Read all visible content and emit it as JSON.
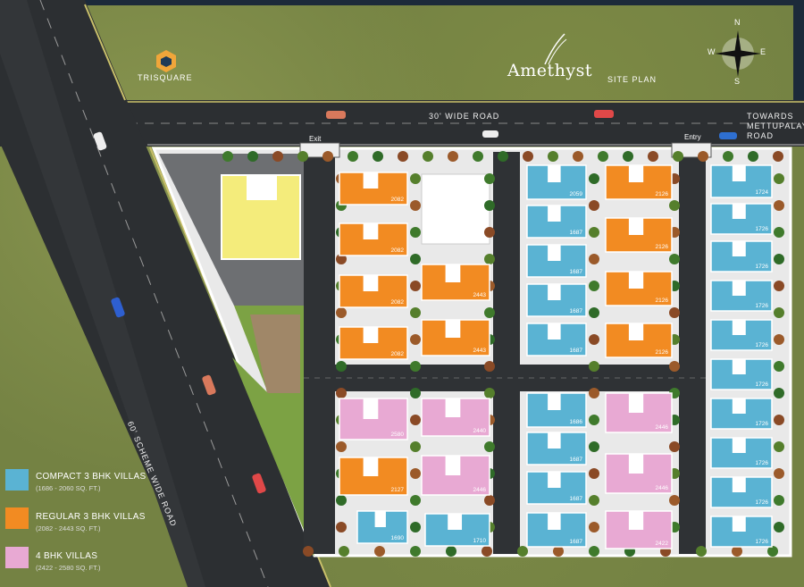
{
  "header": {
    "developer": "TRISQUARE",
    "project": "Amethyst",
    "plan_title": "SITE PLAN"
  },
  "compass": {
    "n": "N",
    "s": "S",
    "e": "E",
    "w": "W"
  },
  "roads": {
    "top_road": "30' WIDE ROAD",
    "towards": "TOWARDS METTUPALAYAM ROAD",
    "scheme_road": "60' SCHEME WIDE ROAD"
  },
  "gates": {
    "exit": "Exit",
    "entry": "Entry"
  },
  "legend": [
    {
      "title": "COMPACT 3 BHK VILLAS",
      "sub": "(1686 - 2060 SQ. FT.)",
      "color": "#5ab3d3"
    },
    {
      "title": "REGULAR 3 BHK VILLAS",
      "sub": "(2082 - 2443 SQ. FT.)",
      "color": "#f28b22"
    },
    {
      "title": "4 BHK VILLAS",
      "sub": "(2422 - 2580 SQ. FT.)",
      "color": "#e8a9d3"
    }
  ],
  "plots": [
    {
      "t": "o",
      "v": "2082"
    },
    {
      "t": "o",
      "v": "2082"
    },
    {
      "t": "o",
      "v": "2082"
    },
    {
      "t": "o",
      "v": "2082"
    },
    {
      "t": "o",
      "v": "2443"
    },
    {
      "t": "o",
      "v": "2443"
    },
    {
      "t": "b",
      "v": "2059"
    },
    {
      "t": "b",
      "v": "1687"
    },
    {
      "t": "b",
      "v": "1687"
    },
    {
      "t": "b",
      "v": "1687"
    },
    {
      "t": "b",
      "v": "1687"
    },
    {
      "t": "o",
      "v": "2126"
    },
    {
      "t": "o",
      "v": "2126"
    },
    {
      "t": "o",
      "v": "2126"
    },
    {
      "t": "o",
      "v": "2126"
    },
    {
      "t": "b",
      "v": "1724"
    },
    {
      "t": "b",
      "v": "1726"
    },
    {
      "t": "b",
      "v": "1726"
    },
    {
      "t": "b",
      "v": "1726"
    },
    {
      "t": "b",
      "v": "1726"
    },
    {
      "t": "b",
      "v": "1726"
    },
    {
      "t": "b",
      "v": "1726"
    },
    {
      "t": "b",
      "v": "1726"
    },
    {
      "t": "b",
      "v": "1726"
    },
    {
      "t": "b",
      "v": "1726"
    },
    {
      "t": "b",
      "v": "1726"
    },
    {
      "t": "p",
      "v": "2580"
    },
    {
      "t": "o",
      "v": "2127"
    },
    {
      "t": "b",
      "v": "1690"
    },
    {
      "t": "b",
      "v": "1710"
    },
    {
      "t": "p",
      "v": "2440"
    },
    {
      "t": "p",
      "v": "2446"
    },
    {
      "t": "b",
      "v": "1686"
    },
    {
      "t": "b",
      "v": "1687"
    },
    {
      "t": "b",
      "v": "1687"
    },
    {
      "t": "b",
      "v": "1687"
    },
    {
      "t": "p",
      "v": "2446"
    },
    {
      "t": "p",
      "v": "2446"
    },
    {
      "t": "p",
      "v": "2422"
    }
  ]
}
